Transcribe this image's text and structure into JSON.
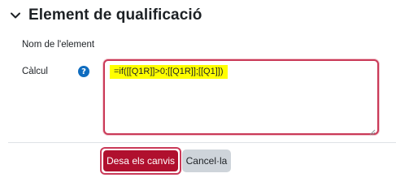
{
  "section": {
    "title": "Element de qualificació",
    "toggle_icon": "chevron-down-icon"
  },
  "fields": {
    "name_label": "Nom de l'element",
    "calc_label": "Càlcul",
    "help_icon": "question-circle-icon",
    "help_glyph": "?",
    "calc_value": "=if([[Q1R]]>0;[[Q1R]];[[Q1]])"
  },
  "buttons": {
    "save_label": "Desa els canvis",
    "cancel_label": "Cancel·la"
  },
  "colors": {
    "accent_error": "#ca3a58",
    "save_bg": "#b0102e",
    "highlight": "#ffff00",
    "help_bg": "#0f6cbf",
    "cancel_bg": "#ced4da"
  }
}
